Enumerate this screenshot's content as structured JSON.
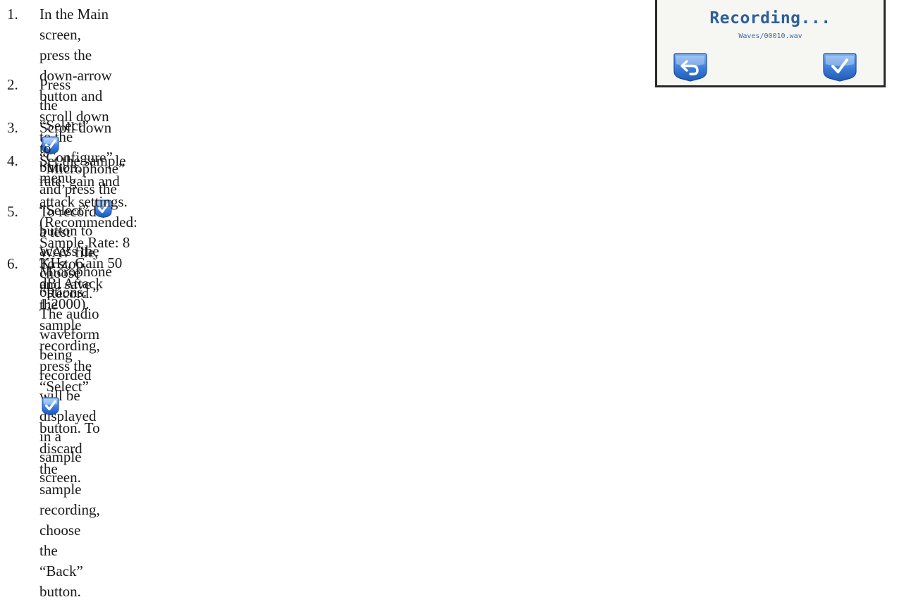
{
  "steps": [
    {
      "number": "1.",
      "line1": "In the Main screen, press the down-arrow button and scroll down to the",
      "line2": "“Configure” menu."
    },
    {
      "number": "2.",
      "before": "Press the “Select” ",
      "after": "button."
    },
    {
      "number": "3.",
      "before": "Scroll down to “Microphone” and press the “Select” ",
      "after": "button to access the Microphone options."
    },
    {
      "number": "4.",
      "line1": "Set the sample rate, gain and attack settings. (Recommended: Sample Rate: 8 KHz, Gain 50 dB, Attack",
      "line2": "1:2000)."
    },
    {
      "number": "5.",
      "line1": "To record a test WAV file, choose “Record.” The audio waveform being recorded will be displayed in a",
      "line2": "sample screen."
    },
    {
      "number": "6.",
      "before": "To stop and save the sample recording, press the “Select” ",
      "after": "button. To discard the sample recording,",
      "line2": "choose the “Back” button."
    }
  ],
  "device_screen": {
    "status": "Recording...",
    "filename": "Waves/00010.wav",
    "back_icon": "back-arrow-icon",
    "select_icon": "checkmark-icon"
  },
  "colors": {
    "icon_blue": "#3a78d8",
    "screen_text": "#2f5f9a"
  }
}
